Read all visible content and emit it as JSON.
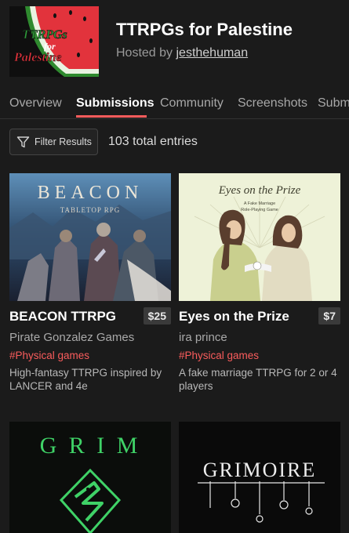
{
  "jam": {
    "title": "TTRPGs for Palestine",
    "hosted_prefix": "Hosted by ",
    "host": "jesthehuman",
    "logo_text": [
      "TTRPGs",
      "for",
      "Palestine"
    ]
  },
  "tabs": [
    {
      "label": "Overview",
      "active": false
    },
    {
      "label": "Submissions",
      "active": true
    },
    {
      "label": "Community",
      "active": false
    },
    {
      "label": "Screenshots",
      "active": false
    },
    {
      "label": "Subm",
      "active": false
    }
  ],
  "toolbar": {
    "filter_label": "Filter Results",
    "entries_count": "103 total entries"
  },
  "colors": {
    "accent": "#fa5c5c",
    "background": "#1b1b1b",
    "price_badge": "#3a3a3a"
  },
  "games": [
    {
      "title": "BEACON TTRPG",
      "price": "$25",
      "author": "Pirate Gonzalez Games",
      "tag": "#Physical games",
      "description": "High-fantasy TTRPG inspired by LANCER and 4e",
      "cover_title": "BEACON",
      "cover_subtitle": "TABLETOP RPG"
    },
    {
      "title": "Eyes on the Prize",
      "price": "$7",
      "author": "ira prince",
      "tag": "#Physical games",
      "description": "A fake marriage TTRPG for 2 or 4 players",
      "cover_title": "Eyes on the Prize",
      "cover_subtitle": [
        "A Fake Marriage",
        "Role-Playing Game"
      ]
    },
    {
      "cover_title": "G R I M"
    },
    {
      "cover_title": "GRIMOIRE"
    }
  ]
}
